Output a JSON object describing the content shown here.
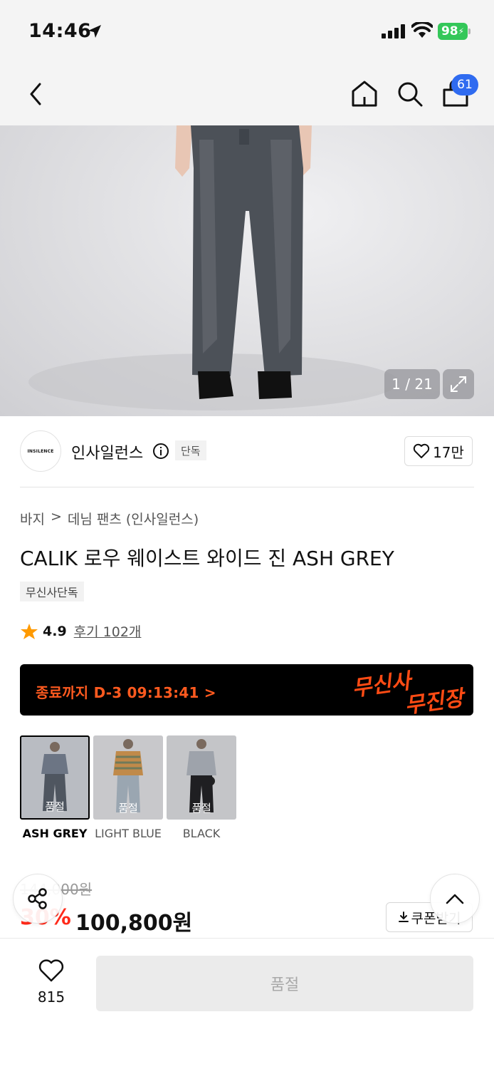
{
  "status_bar": {
    "time": "14:46",
    "battery": "98"
  },
  "nav": {
    "cart_count": "61"
  },
  "gallery": {
    "counter": "1 / 21"
  },
  "brand": {
    "logo_text": "INSILENCE",
    "name": "인사일런스",
    "tag": "단독",
    "likes": "17만"
  },
  "breadcrumb": {
    "category": "바지",
    "separator": ">",
    "subcategory": "데님 팬츠 (인사일런스)"
  },
  "product": {
    "title": "CALIK 로우 웨이스트 와이드 진 ASH GREY",
    "tag": "무신사단독",
    "rating": "4.9",
    "reviews": "후기 102개"
  },
  "promo": {
    "countdown": "종료까지 D-3 09:13:41 >",
    "logo_line1": "무신사",
    "logo_line2": "무진장",
    "accent_color": "#ff4b14"
  },
  "options": [
    {
      "label": "ASH GREY",
      "status": "품절",
      "selected": true
    },
    {
      "label": "LIGHT BLUE",
      "status": "품절",
      "selected": false
    },
    {
      "label": "BLACK",
      "status": "품절",
      "selected": false
    }
  ],
  "price": {
    "original": "144,000원",
    "discount": "30%",
    "final": "100,800원",
    "coupon": "쿠폰받기",
    "discount_color": "#ff2a1a"
  },
  "bottom": {
    "wish_count": "815",
    "buy_label": "품절"
  }
}
